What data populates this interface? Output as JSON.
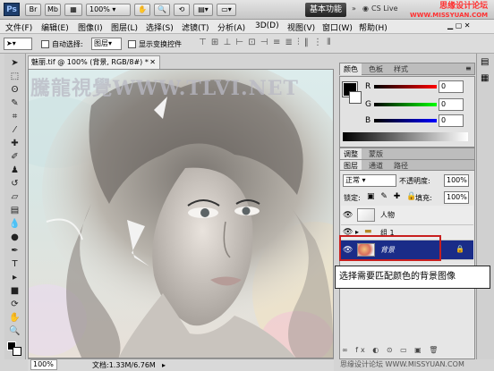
{
  "titlebar": {
    "ps_logo": "Ps",
    "br_logo": "Br",
    "mb_logo": "Mb",
    "zoom": "100%",
    "workspace": "基本功能",
    "cs_live": "CS Live",
    "watermark_line1": "思缘设计论坛",
    "watermark_line2": "WWW.MISSYUAN.COM"
  },
  "menu": [
    "文件(F)",
    "编辑(E)",
    "图像(I)",
    "图层(L)",
    "选择(S)",
    "滤镜(T)",
    "分析(A)",
    "3D(D)",
    "视图(V)",
    "窗口(W)",
    "帮助(H)"
  ],
  "options": {
    "auto_select_label": "自动选择:",
    "auto_select_value": "图层",
    "show_transform_label": "显示变换控件"
  },
  "document": {
    "tab_title": "魅丽.tif @ 100% (背景, RGB/8#) *",
    "watermark": "騰龍視覺WWW.TLVI.NET",
    "zoom": "100%",
    "doc_size": "文档:1.33M/6.76M"
  },
  "color_panel": {
    "tabs": [
      "颜色",
      "色板",
      "样式"
    ],
    "r_label": "R",
    "g_label": "G",
    "b_label": "B",
    "r_value": "0",
    "g_value": "0",
    "b_value": "0"
  },
  "adjust_tabs": [
    "调整",
    "蒙版"
  ],
  "layers_panel": {
    "tabs": [
      "图层",
      "通道",
      "路径"
    ],
    "blend_mode": "正常",
    "opacity_label": "不透明度:",
    "opacity_value": "100%",
    "lock_label": "锁定:",
    "fill_label": "填充:",
    "fill_value": "100%",
    "layers": [
      {
        "name": "人物"
      },
      {
        "name": "组 1"
      },
      {
        "name": "背景"
      }
    ]
  },
  "callout": "选择需要匹配颜色的背景图像",
  "bottom_watermark": "思缘设计论坛 WWW.MISSYUAN.COM"
}
